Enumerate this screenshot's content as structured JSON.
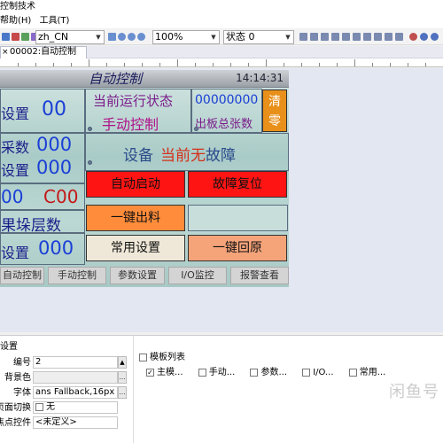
{
  "window": {
    "title": "控制技术"
  },
  "menu": {
    "items": [
      "帮助(H)",
      "工具(T)"
    ]
  },
  "toolbar": {
    "language": "zh_CN",
    "zoom": "100%",
    "state": "状态 0"
  },
  "tab": {
    "label": "00002:自动控制"
  },
  "hmi": {
    "title": "自动控制",
    "clock": "14:14:31",
    "left_top_label": "设置",
    "left_top_value": "00",
    "status_label": "当前运行状态",
    "status_value": "手动控制",
    "counter_value": "00000000",
    "counter_label": "出板总张数",
    "clear_label": "清零",
    "left_mid_label1": "采数",
    "left_mid_value1": "000",
    "left_mid_label2": "设置",
    "left_mid_value2": "000",
    "fault_prefix": "设备",
    "fault_overlay": "当前无",
    "fault_suffix": "故障",
    "left_row3_value1": "00",
    "left_row3_value2": "C00",
    "left_row4_label": "果垛层数",
    "left_row5_label": "设置",
    "left_row5_value": "000",
    "btn_auto_start": "自动启动",
    "btn_fault_reset": "故障复位",
    "btn_feed": "一键出料",
    "btn_common": "常用设置",
    "btn_home": "一键回原",
    "nav": [
      "自动控制",
      "手动控制",
      "参数设置",
      "I/O监控",
      "报警查看"
    ]
  },
  "props": {
    "section": "设置",
    "rows": [
      {
        "label": "编号",
        "value": "2"
      },
      {
        "label": "背景色",
        "value": ""
      },
      {
        "label": "字体",
        "value": "ans Fallback,16px"
      },
      {
        "label": "页面切换",
        "value": "无"
      },
      {
        "label": "焦点控件",
        "value": "<未定义>"
      }
    ]
  },
  "templates": {
    "title": "模板列表",
    "items": [
      "主模...",
      "手动...",
      "参数...",
      "I/O...",
      "常用..."
    ]
  },
  "watermark": "闲鱼号"
}
